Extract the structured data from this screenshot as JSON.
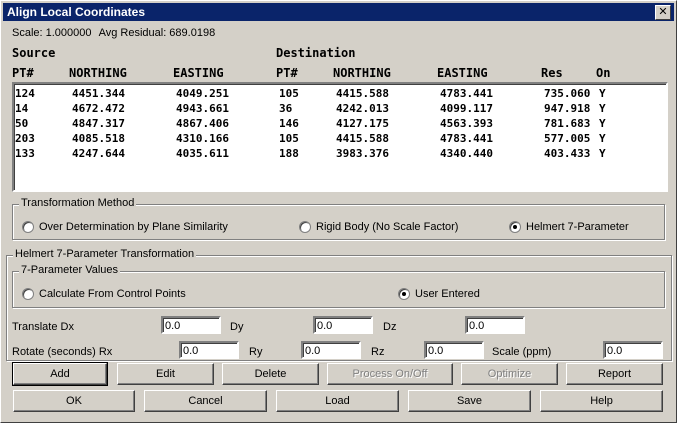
{
  "window": {
    "title": "Align Local Coordinates",
    "close": "✕"
  },
  "summary": {
    "scale_text": "Scale: 1.000000",
    "residual_text": "Avg Residual: 689.0198"
  },
  "headers": {
    "source": "Source",
    "destination": "Destination",
    "src_pt": "PT#",
    "src_northing": "NORTHING",
    "src_easting": "EASTING",
    "dst_pt": "PT#",
    "dst_northing": "NORTHING",
    "dst_easting": "EASTING",
    "res": "Res",
    "on": "On"
  },
  "rows": [
    [
      "124",
      "4451.344",
      "4049.251",
      "105",
      "4415.588",
      "4783.441",
      "735.060",
      "Y"
    ],
    [
      "14",
      "4672.472",
      "4943.661",
      "36",
      "4242.013",
      "4099.117",
      "947.918",
      "Y"
    ],
    [
      "50",
      "4847.317",
      "4867.406",
      "146",
      "4127.175",
      "4563.393",
      "781.683",
      "Y"
    ],
    [
      "203",
      "4085.518",
      "4310.166",
      "105",
      "4415.588",
      "4783.441",
      "577.005",
      "Y"
    ],
    [
      "133",
      "4247.644",
      "4035.611",
      "188",
      "3983.376",
      "4340.440",
      "403.433",
      "Y"
    ]
  ],
  "transformation": {
    "group_label": "Transformation Method",
    "opt1": "Over Determination by Plane Similarity",
    "opt2": "Rigid Body (No Scale Factor)",
    "opt3": "Helmert 7-Parameter",
    "selected": "opt3"
  },
  "helmert": {
    "group_label": "Helmert 7-Parameter Transformation",
    "values_label": "7-Parameter Values",
    "calc_label": "Calculate From Control Points",
    "user_label": "User Entered",
    "selected": "user",
    "translate_label": "Translate Dx",
    "dx": "0.0",
    "dy_label": "Dy",
    "dy": "0.0",
    "dz_label": "Dz",
    "dz": "0.0",
    "rotate_label": "Rotate (seconds) Rx",
    "rx": "0.0",
    "ry_label": "Ry",
    "ry": "0.0",
    "rz_label": "Rz",
    "rz": "0.0",
    "scale_label": "Scale (ppm)",
    "scale": "0.0"
  },
  "buttons": {
    "add": "Add",
    "edit": "Edit",
    "delete": "Delete",
    "process": "Process On/Off",
    "optimize": "Optimize",
    "report": "Report",
    "ok": "OK",
    "cancel": "Cancel",
    "load": "Load",
    "save": "Save",
    "help": "Help"
  }
}
